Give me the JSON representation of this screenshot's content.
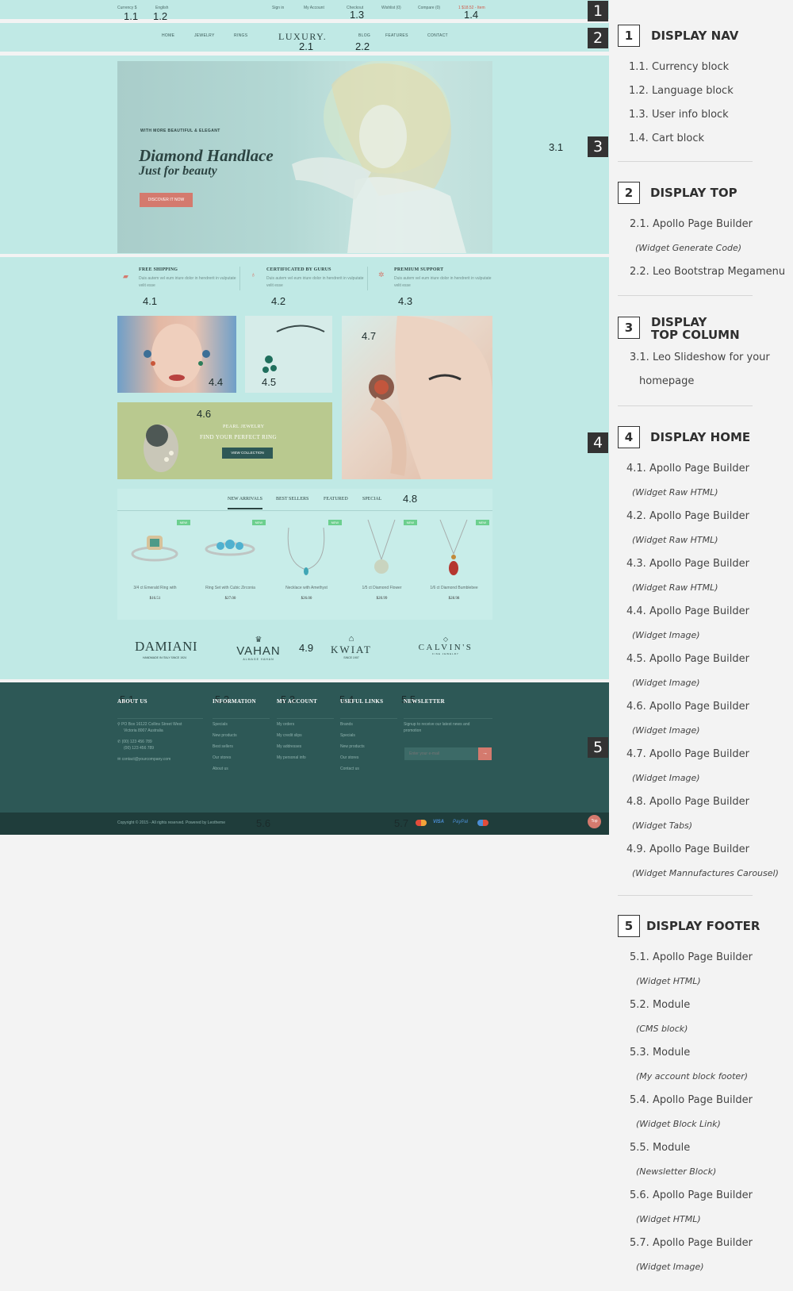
{
  "topnav": {
    "currency": "Currency $",
    "language": "English",
    "signin": "Sign in",
    "account": "My Account",
    "checkout": "Checkout",
    "wishlist": "Wishlist (0)",
    "compare": "Compare (0)",
    "cart": "1 $18.52 - Item"
  },
  "mainnav": {
    "home": "HOME",
    "jewelry": "JEWELRY",
    "rings": "RINGS",
    "logo": "LUXURY.",
    "blog": "BLOG",
    "features": "FEATURES",
    "contact": "CONTACT"
  },
  "hero": {
    "eyebrow": "WITH MORE BEAUTIFUL & ELEGANT",
    "title1": "Diamond Handlace",
    "title2": "Just for beauty",
    "button": "DISCOVER IT NOW"
  },
  "features": [
    {
      "title": "FREE SHIPPING",
      "text": "Duis autem vel eum iriure dolor in hendrerit in vulputate velit esse"
    },
    {
      "title": "CERTIFICATED BY GURUS",
      "text": "Duis autem vel eum iriure dolor in hendrerit in vulputate velit esse"
    },
    {
      "title": "PREMIUM SUPPORT",
      "text": "Duis autem vel eum iriure dolor in hendrerit in vulputate velit esse"
    }
  ],
  "banner": {
    "sub": "PEARL JEWELRY",
    "title": "FIND YOUR PERFECT RING",
    "button": "VIEW COLLECTION"
  },
  "tabs": [
    "NEW ARRIVALS",
    "BEST SELLERS",
    "FEATURED",
    "SPECIAL"
  ],
  "products": [
    {
      "badge": "NEW",
      "name": "3/4 ct Emerald Ring with",
      "price": "$16.51"
    },
    {
      "badge": "NEW",
      "name": "Ring Set with Cubic Zirconia",
      "price": "$27.00"
    },
    {
      "badge": "NEW",
      "name": "Necklace with Amethyst",
      "price": "$26.00"
    },
    {
      "badge": "NEW",
      "name": "1/5 ct Diamond Flower",
      "price": "$20.99"
    },
    {
      "badge": "NEW",
      "name": "1/6 ct Diamond Bumblebee",
      "price": "$28.98"
    }
  ],
  "brands": {
    "damiani": "DAMIANI",
    "damiani_sub": "HANDMADE IN ITALY SINCE 1924",
    "vahan": "VAHAN",
    "vahan_sub": "ALMAGE VAHAN",
    "kwiat": "KWIAT",
    "kwiat_sub": "SINCE 1907",
    "calvins": "CALVIN'S",
    "calvins_sub": "FINE JEWELRY"
  },
  "footer": {
    "about": {
      "title": "ABOUT US",
      "address": "PO Box 16122 Collins Street West",
      "address2": "Victoria 8007 Australia",
      "phone1": "(00) 123 456 789",
      "phone2": "(00) 123 456 789",
      "email": "contact@yourcompany.com"
    },
    "info": {
      "title": "INFORMATION",
      "items": [
        "Specials",
        "New products",
        "Best sellers",
        "Our stores",
        "About us"
      ]
    },
    "account": {
      "title": "MY ACCOUNT",
      "items": [
        "My orders",
        "My credit slips",
        "My addresses",
        "My personal info"
      ]
    },
    "links": {
      "title": "USEFUL LINKS",
      "items": [
        "Brands",
        "Specials",
        "New products",
        "Our stores",
        "Contact us"
      ]
    },
    "newsletter": {
      "title": "NEWSLETTER",
      "text": "Signup to receive our latest news and",
      "text2": "promotion",
      "placeholder": "Enter your e-mail"
    },
    "copyright": "Copyright © 2015 - All rights reserved. Powered by Leotheme",
    "top": "Top",
    "payments": [
      "VISA",
      "PayPal"
    ]
  },
  "markers": {
    "m11": "1.1",
    "m12": "1.2",
    "m13": "1.3",
    "m14": "1.4",
    "m21": "2.1",
    "m22": "2.2",
    "m31": "3.1",
    "m41": "4.1",
    "m42": "4.2",
    "m43": "4.3",
    "m44": "4.4",
    "m45": "4.5",
    "m46": "4.6",
    "m47": "4.7",
    "m48": "4.8",
    "m49": "4.9",
    "m51": "5.1",
    "m52": "5.2",
    "m53": "5.3",
    "m54": "5.4",
    "m55": "5.5",
    "m56": "5.6",
    "m57": "5.7"
  },
  "badges": [
    "1",
    "2",
    "3",
    "4",
    "5"
  ],
  "legend": {
    "s1": {
      "num": "1",
      "title": "DISPLAY NAV",
      "items": [
        "1.1. Currency block",
        "1.2. Language block",
        "1.3. User info block",
        "1.4. Cart block"
      ]
    },
    "s2": {
      "num": "2",
      "title": "DISPLAY TOP",
      "items": [
        "2.1. Apollo Page Builder",
        "(Widget Generate Code)",
        "2.2. Leo Bootstrap Megamenu"
      ]
    },
    "s3": {
      "num": "3",
      "title1": "DISPLAY",
      "title2": "TOP COLUMN",
      "items": [
        "3.1. Leo Slideshow for your",
        "homepage"
      ]
    },
    "s4": {
      "num": "4",
      "title": "DISPLAY HOME",
      "items": [
        "4.1. Apollo Page Builder",
        "(Widget Raw HTML)",
        "4.2. Apollo Page Builder",
        "(Widget Raw HTML)",
        "4.3. Apollo Page Builder",
        "(Widget Raw HTML)",
        "4.4. Apollo Page Builder",
        "(Widget Image)",
        "4.5. Apollo Page Builder",
        "(Widget Image)",
        "4.6. Apollo Page Builder",
        "(Widget Image)",
        "4.7. Apollo Page Builder",
        "(Widget Image)",
        "4.8. Apollo Page Builder",
        "(Widget Tabs)",
        "4.9. Apollo Page Builder",
        "(Widget Mannufactures Carousel)"
      ]
    },
    "s5": {
      "num": "5",
      "title": "DISPLAY FOOTER",
      "items": [
        "5.1. Apollo Page Builder",
        "(Widget HTML)",
        "5.2. Module",
        "(CMS block)",
        "5.3. Module",
        "(My account block footer)",
        "5.4. Apollo Page Builder",
        "(Widget Block Link)",
        "5.5. Module",
        "(Newsletter Block)",
        "5.6. Apollo Page Builder",
        "(Widget HTML)",
        "5.7. Apollo Page Builder",
        "(Widget Image)"
      ]
    }
  }
}
